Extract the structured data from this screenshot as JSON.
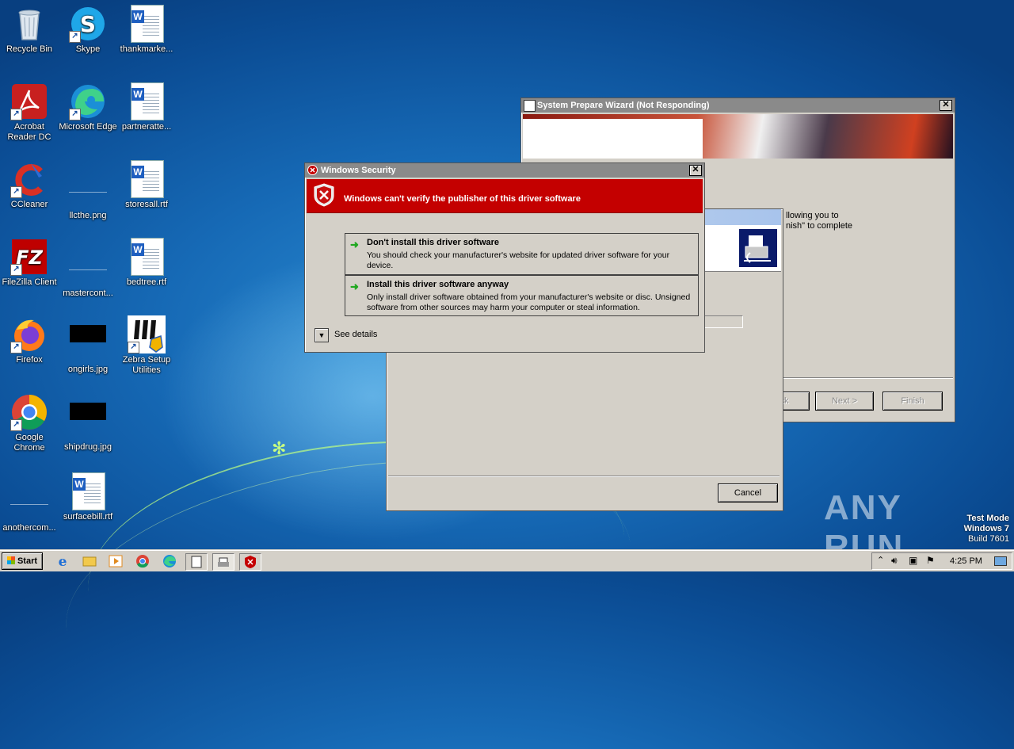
{
  "desktop": {
    "icons": [
      {
        "label": "Recycle Bin",
        "icon": "recycle-bin-icon"
      },
      {
        "label": "Skype",
        "icon": "skype-icon"
      },
      {
        "label": "thankmarke...",
        "icon": "word-document-icon"
      },
      {
        "label": "Acrobat Reader DC",
        "icon": "acrobat-icon"
      },
      {
        "label": "Microsoft Edge",
        "icon": "edge-icon"
      },
      {
        "label": "partneratte...",
        "icon": "word-document-icon"
      },
      {
        "label": "CCleaner",
        "icon": "ccleaner-icon"
      },
      {
        "label": "llcthe.png",
        "icon": "image-file-icon"
      },
      {
        "label": "storesall.rtf",
        "icon": "word-document-icon"
      },
      {
        "label": "FileZilla Client",
        "icon": "filezilla-icon"
      },
      {
        "label": "mastercont...",
        "icon": "image-file-icon"
      },
      {
        "label": "bedtree.rtf",
        "icon": "word-document-icon"
      },
      {
        "label": "Firefox",
        "icon": "firefox-icon"
      },
      {
        "label": "ongirls.jpg",
        "icon": "image-file-icon"
      },
      {
        "label": "Zebra Setup Utilities",
        "icon": "zebra-icon"
      },
      {
        "label": "Google Chrome",
        "icon": "chrome-icon"
      },
      {
        "label": "shipdrug.jpg",
        "icon": "image-file-icon"
      },
      {
        "label": "anothercom...",
        "icon": "file-icon"
      },
      {
        "label": "surfacebill.rtf",
        "icon": "word-document-icon"
      }
    ]
  },
  "wizard": {
    "title": "System Prepare Wizard (Not Responding)",
    "body_line1": "llowing you to",
    "body_line2": "nish\" to complete",
    "back_label": "ck",
    "next_label": "Next >",
    "finish_label": "Finish"
  },
  "install_window": {
    "cancel_label": "Cancel"
  },
  "security_dialog": {
    "title": "Windows Security",
    "header": "Windows can't verify the publisher of this driver software",
    "option1_title": "Don't install this driver software",
    "option1_desc": "You should check your manufacturer's website for updated driver software for your device.",
    "option2_title": "Install this driver software anyway",
    "option2_desc": "Only install driver software obtained from your manufacturer's website or disc. Unsigned software from other sources may harm your computer or steal information.",
    "see_details": "See details",
    "colors": {
      "header_bg": "#c40000",
      "title_bg": "#8a8a8a"
    }
  },
  "watermark": {
    "text": "ANY RUN",
    "line1": "Test Mode",
    "line2": "Windows 7",
    "line3": "Build 7601"
  },
  "taskbar": {
    "start_label": "Start",
    "clock": "4:25 PM",
    "pinned": [
      "ie-icon",
      "explorer-icon",
      "media-player-icon",
      "chrome-icon",
      "edge-icon",
      "wizard-task-icon",
      "printer-task-icon",
      "security-task-icon"
    ]
  }
}
